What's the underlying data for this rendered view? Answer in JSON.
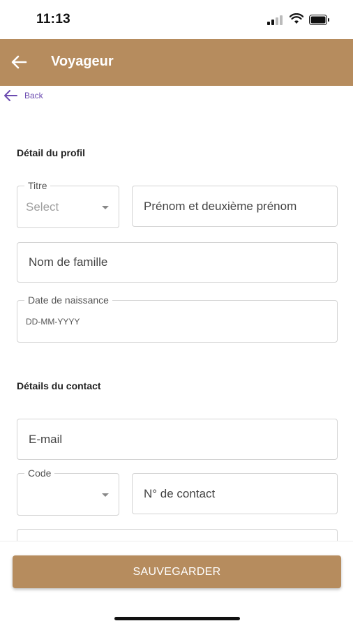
{
  "status_bar": {
    "time": "11:13"
  },
  "app_bar": {
    "title": "Voyageur"
  },
  "back_link": {
    "label": "Back"
  },
  "profile": {
    "title": "Détail du profil",
    "titre": {
      "legend": "Titre",
      "value": "Select"
    },
    "first_name": {
      "placeholder": "Prénom et deuxième prénom"
    },
    "last_name": {
      "placeholder": "Nom de famille"
    },
    "dob": {
      "legend": "Date de naissance",
      "placeholder": "DD-MM-YYYY"
    }
  },
  "contact": {
    "title": "Détails du contact",
    "email": {
      "placeholder": "E-mail"
    },
    "code": {
      "legend": "Code",
      "value": ""
    },
    "phone": {
      "placeholder": "N° de contact"
    }
  },
  "actions": {
    "save_label": "SAUVEGARDER"
  },
  "colors": {
    "accent": "#b68c5e",
    "link": "#6b4bb0"
  }
}
